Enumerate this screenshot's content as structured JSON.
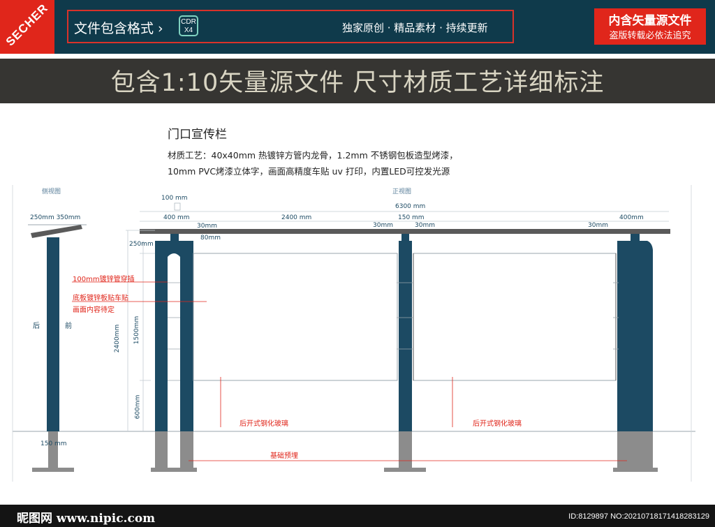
{
  "header": {
    "logo": "SECHER",
    "format_label": "文件包含格式 ›",
    "cdr_line1": "CDR",
    "cdr_line2": "X4",
    "slogan": "独家原创 · 精品素材 · 持续更新",
    "source_line1": "内含矢量源文件",
    "source_line2": "盗版转载必依法追究"
  },
  "banner": "包含1:10矢量源文件  尺寸材质工艺详细标注",
  "description": {
    "title": "门口宣传栏",
    "line1": "材质工艺：40x40mm 热镀锌方管内龙骨，1.2mm 不锈钢包板造型烤漆，",
    "line2": "10mm PVC烤漆立体字，画面高精度车贴 uv 打印，内置LED可控发光源"
  },
  "labels": {
    "side_view": "侧视图",
    "front_view": "正视图",
    "back": "后",
    "front": "前",
    "pipe_note": "100mm镀锌管穿插",
    "board_note": "底板镀锌板贴车贴",
    "content_note": "画面内容待定",
    "glass_left": "后开式钢化玻璃",
    "glass_right": "后开式钢化玻璃",
    "foundation": "基础预埋"
  },
  "dimensions": {
    "d250_350": "250mm 350mm",
    "d100": "100 mm",
    "d6300": "6300 mm",
    "d400_left": "400 mm",
    "d2400_top": "2400 mm",
    "d150": "150 mm",
    "d400_right": "400mm",
    "d30_a": "30mm",
    "d30_b": "30mm",
    "d30_c": "30mm",
    "d30_d": "30mm",
    "d80": "80mm",
    "d250": "250mm",
    "d2400_vert": "2400mm",
    "d1500": "1500mm",
    "d600": "600mm",
    "d150_bottom": "150 mm"
  },
  "footer": {
    "site": "昵图网 www.nipic.com",
    "id": "ID:8129897 NO:20210718171418283129"
  },
  "colors": {
    "header_bg": "#0f3a4b",
    "accent_red": "#e0261b",
    "banner_bg": "#363532",
    "post_blue": "#1c4a63",
    "foundation_gray": "#8c8c8c",
    "note_red": "#e0261b"
  }
}
